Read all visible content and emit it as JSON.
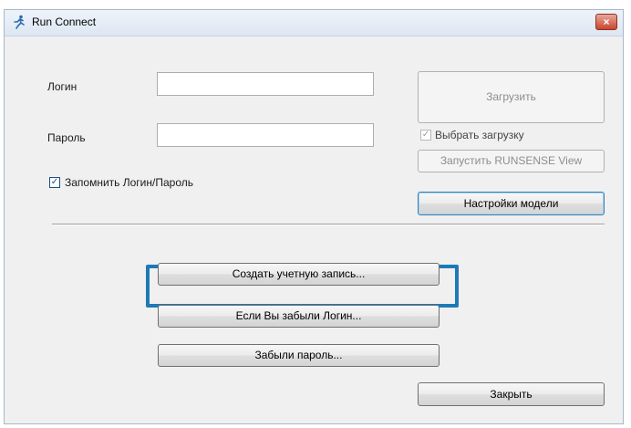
{
  "window": {
    "title": "Run Connect",
    "close_symbol": "×"
  },
  "login": {
    "label": "Логин",
    "value": ""
  },
  "password": {
    "label": "Пароль",
    "value": ""
  },
  "remember": {
    "label": "Запомнить Логин/Пароль",
    "checked": true
  },
  "upload": {
    "label": "Загрузить"
  },
  "select_upload": {
    "label": "Выбрать загрузку",
    "checked": true
  },
  "runsense": {
    "label": "Запустить RUNSENSE View"
  },
  "model_settings": {
    "label": "Настройки модели"
  },
  "create_account": {
    "label": "Создать учетную запись..."
  },
  "forgot_login": {
    "label": "Если Вы забыли Логин..."
  },
  "forgot_password": {
    "label": "Забыли пароль..."
  },
  "close": {
    "label": "Закрыть"
  },
  "colors": {
    "highlight": "#1d7ab6",
    "close_button": "#c9442e"
  },
  "icons": {
    "app": "runner-icon",
    "close": "close-icon",
    "check": "checkmark-icon"
  }
}
